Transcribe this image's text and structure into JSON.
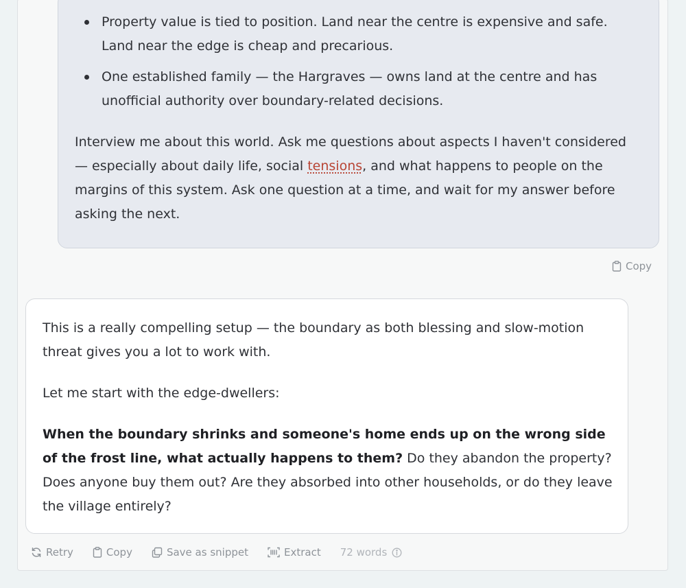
{
  "user_message": {
    "bullets": [
      "Property value is tied to position. Land near the centre is expensive and safe. Land near the edge is cheap and precarious.",
      "One established family — the Hargraves — owns land at the centre and has unofficial authority over boundary-related decisions."
    ],
    "closing_before": "Interview me about this world. Ask me questions about aspects I haven't considered — especially about daily life, social ",
    "closing_highlight": "tensions",
    "closing_after": ", and what happens to people on the margins of this system. Ask one question at a time, and wait for my answer before asking the next.",
    "copy_label": "Copy"
  },
  "assistant_message": {
    "para1": "This is a really compelling setup — the boundary as both blessing and slow-motion threat gives you a lot to work with.",
    "para2": "Let me start with the edge-dwellers:",
    "para3_bold": "When the boundary shrinks and someone's home ends up on the wrong side of the frost line, what actually happens to them?",
    "para3_rest": " Do they abandon the property? Does anyone buy them out? Are they absorbed into other households, or do they leave the village entirely?"
  },
  "actions": {
    "retry": "Retry",
    "copy": "Copy",
    "snippet": "Save as snippet",
    "extract": "Extract",
    "word_count": "72 words"
  },
  "icons": {
    "retry": "retry-icon",
    "copy": "clipboard-icon",
    "snippet": "snippet-icon",
    "extract": "extract-icon",
    "info": "info-icon"
  },
  "colors": {
    "background": "#eef3f4",
    "user_bubble": "#e7eaf0",
    "assistant_bubble": "#ffffff",
    "highlight": "#b84434",
    "muted": "#8e9399"
  }
}
